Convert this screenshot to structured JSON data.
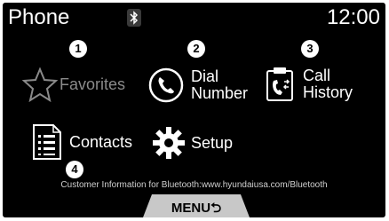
{
  "header": {
    "title": "Phone",
    "time": "12:00",
    "status_icon": "bluetooth-icon"
  },
  "menu": {
    "favorites": {
      "label": "Favorites",
      "badge": "1",
      "icon": "star-icon"
    },
    "dial_number": {
      "line1": "Dial",
      "line2": "Number",
      "badge": "2",
      "icon": "phone-handset-icon"
    },
    "call_history": {
      "line1": "Call",
      "line2": "History",
      "badge": "3",
      "icon": "call-history-icon"
    },
    "contacts": {
      "label": "Contacts",
      "badge": "4",
      "icon": "contacts-list-icon"
    },
    "setup": {
      "label": "Setup",
      "icon": "gear-icon"
    }
  },
  "footer": {
    "info_text": "Customer Information for Bluetooth:www.hyundaiusa.com/Bluetooth",
    "menu_button": "MENU⮌"
  }
}
